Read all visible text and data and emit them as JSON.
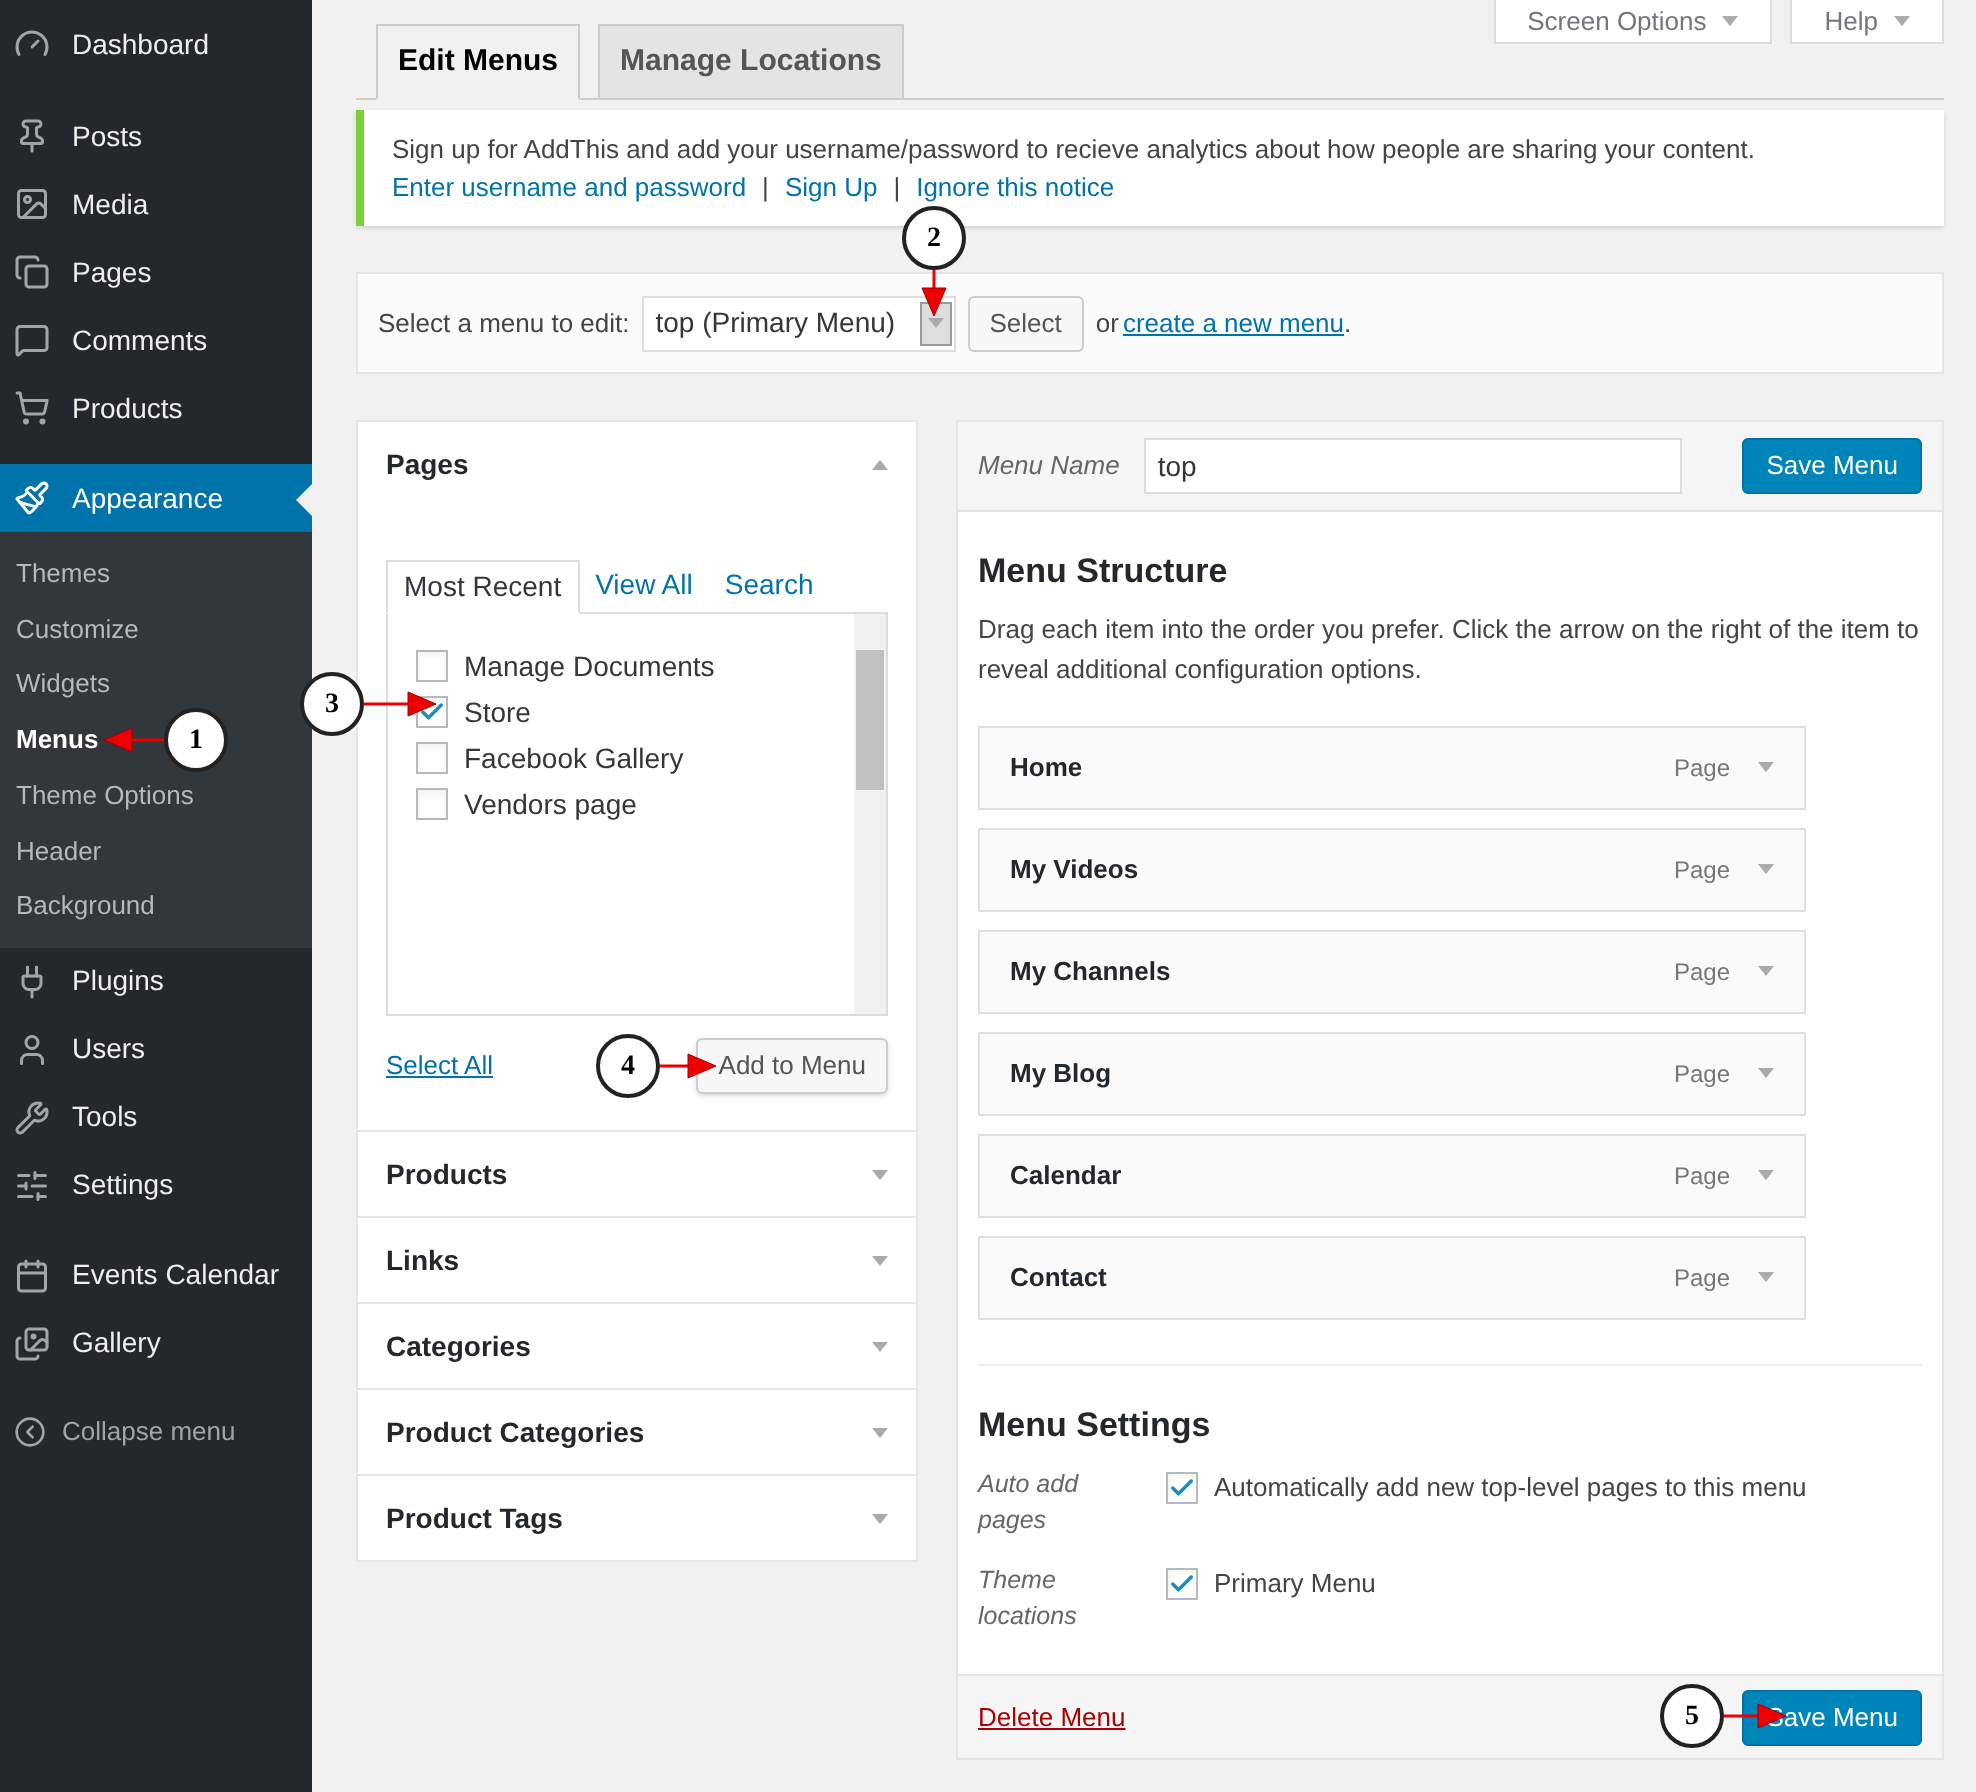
{
  "sidebar": {
    "groups": [
      [
        {
          "label": "Dashboard",
          "selected": false
        }
      ],
      [
        {
          "label": "Posts",
          "selected": false
        },
        {
          "label": "Media",
          "selected": false
        },
        {
          "label": "Pages",
          "selected": false
        },
        {
          "label": "Comments",
          "selected": false
        },
        {
          "label": "Products",
          "selected": false
        }
      ],
      [
        {
          "label": "Appearance",
          "selected": true,
          "children": [
            {
              "label": "Themes",
              "selected": false
            },
            {
              "label": "Customize",
              "selected": false
            },
            {
              "label": "Widgets",
              "selected": false
            },
            {
              "label": "Menus",
              "selected": true
            },
            {
              "label": "Theme Options",
              "selected": false
            },
            {
              "label": "Header",
              "selected": false
            },
            {
              "label": "Background",
              "selected": false
            }
          ]
        },
        {
          "label": "Plugins",
          "selected": false
        },
        {
          "label": "Users",
          "selected": false
        },
        {
          "label": "Tools",
          "selected": false
        },
        {
          "label": "Settings",
          "selected": false
        }
      ],
      [
        {
          "label": "Events Calendar",
          "selected": false
        },
        {
          "label": "Gallery",
          "selected": false
        }
      ]
    ],
    "collapse": "Collapse menu"
  },
  "screen_buttons": [
    "Screen Options",
    "Help"
  ],
  "tabs": [
    {
      "label": "Edit Menus",
      "selected": true
    },
    {
      "label": "Manage Locations",
      "selected": false
    }
  ],
  "notice": {
    "text": "Sign up for AddThis and add your username/password to recieve analytics about how people are sharing your content.",
    "links": [
      "Enter username and password",
      "Sign Up",
      "Ignore this notice"
    ],
    "separators": [
      "|",
      "|"
    ]
  },
  "menu_select": {
    "label": "Select a menu to edit:",
    "value": "top (Primary Menu)",
    "button": "Select",
    "or": "or",
    "link": "create a new menu",
    "end": "."
  },
  "sections": [
    {
      "title": "Pages",
      "expanded": true,
      "tabs": [
        {
          "label": "Most Recent",
          "selected": true
        },
        {
          "label": "View All",
          "selected": false
        },
        {
          "label": "Search",
          "selected": false
        }
      ],
      "items": [
        {
          "label": "Manage Documents",
          "checked": false
        },
        {
          "label": "Store",
          "checked": true
        },
        {
          "label": "Facebook Gallery",
          "checked": false
        },
        {
          "label": "Vendors page",
          "checked": false
        }
      ],
      "select_all": "Select All",
      "add_button": "Add to Menu"
    },
    {
      "title": "Products",
      "expanded": false
    },
    {
      "title": "Links",
      "expanded": false
    },
    {
      "title": "Categories",
      "expanded": false
    },
    {
      "title": "Product Categories",
      "expanded": false
    },
    {
      "title": "Product Tags",
      "expanded": false
    }
  ],
  "editor": {
    "name_label": "Menu Name",
    "name_value": "top",
    "save": "Save Menu",
    "structure_title": "Menu Structure",
    "structure_hint": "Drag each item into the order you prefer. Click the arrow on the right of the item to reveal additional configuration options.",
    "items": [
      {
        "label": "Home",
        "type": "Page"
      },
      {
        "label": "My Videos",
        "type": "Page"
      },
      {
        "label": "My Channels",
        "type": "Page"
      },
      {
        "label": "My Blog",
        "type": "Page"
      },
      {
        "label": "Calendar",
        "type": "Page"
      },
      {
        "label": "Contact",
        "type": "Page"
      }
    ],
    "settings_title": "Menu Settings",
    "settings": [
      {
        "label": "Auto add pages",
        "option": "Automatically add new top-level pages to this menu",
        "checked": true
      },
      {
        "label": "Theme locations",
        "option": "Primary Menu",
        "checked": true
      }
    ],
    "delete": "Delete Menu",
    "save_bottom": "Save Menu"
  },
  "callouts": [
    {
      "number": "1"
    },
    {
      "number": "2"
    },
    {
      "number": "3"
    },
    {
      "number": "4"
    },
    {
      "number": "5"
    }
  ]
}
